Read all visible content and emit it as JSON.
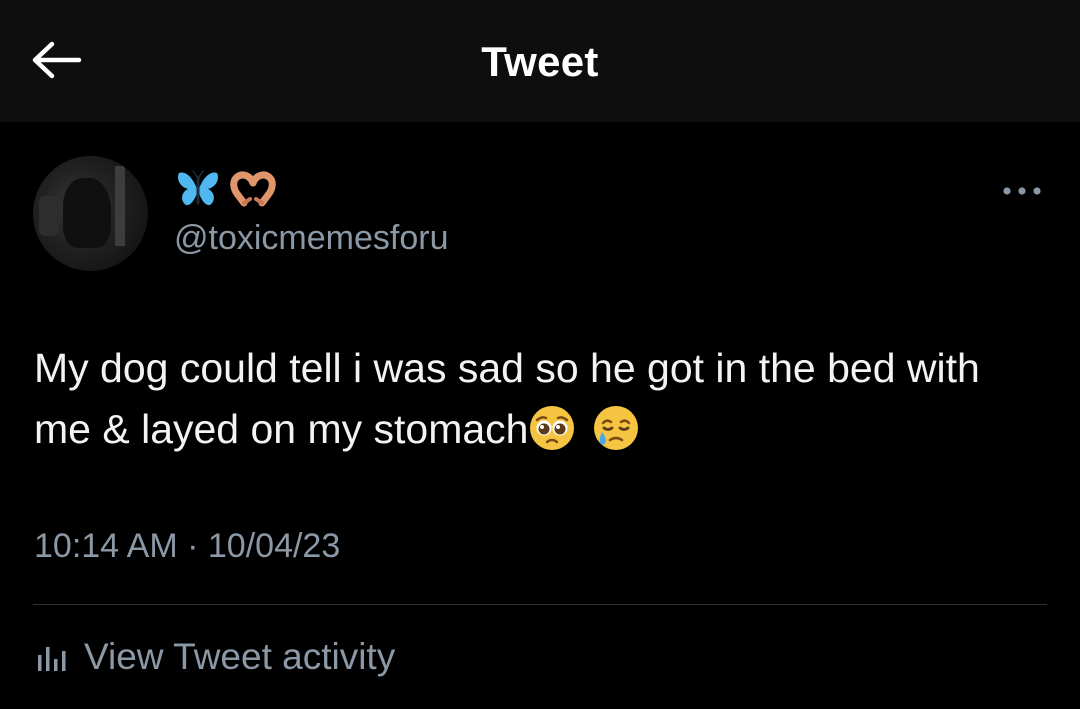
{
  "header": {
    "title": "Tweet",
    "back_icon": "arrow-left-icon"
  },
  "author": {
    "display_name_icons": [
      "butterfly-emoji-icon",
      "heart-hands-emoji-icon"
    ],
    "handle": "@toxicmemesforu",
    "avatar": "profile-photo"
  },
  "tweet": {
    "text": "My dog could tell i was sad so he got in the bed with me & layed on my stomach",
    "emojis": [
      "pleading-face-emoji-icon",
      "smiling-face-with-tear-emoji-icon"
    ],
    "time": "10:14 AM",
    "separator": "·",
    "date": "10/04/23"
  },
  "actions": {
    "more_icon": "more-horizontal-icon",
    "activity_icon": "analytics-bars-icon",
    "activity_label": "View Tweet activity"
  },
  "colors": {
    "background": "#000000",
    "header_background": "#0e0e0e",
    "primary_text": "#e7e9ea",
    "secondary_text": "#8b98a5",
    "divider": "#2f3336",
    "butterfly": "#4fb8f0"
  }
}
